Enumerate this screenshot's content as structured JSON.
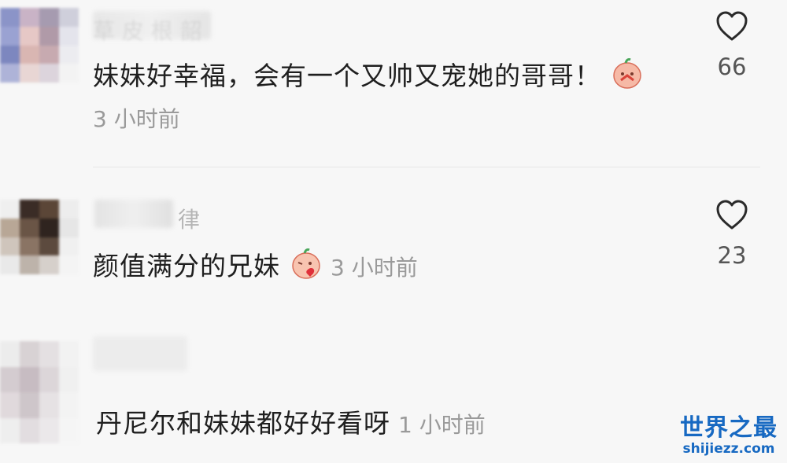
{
  "comments": [
    {
      "username_visible": "草 皮 根 韶",
      "text": "妹妹好幸福，会有一个又帅又宠她的哥哥！",
      "time": "3 小时前",
      "likes": "66",
      "emoji": "praying-face-emoji"
    },
    {
      "username_visible": "律",
      "text": "颜值满分的兄妹",
      "time": "3 小时前",
      "likes": "23",
      "emoji": "kiss-face-emoji"
    },
    {
      "username_visible": "",
      "text": "丹尼尔和妹妹都好好看呀",
      "time": "1 小时前"
    }
  ],
  "watermark": {
    "title": "世界之最",
    "url": "shijiezz.com",
    "color": "#1769c2"
  },
  "icons": {
    "like": "heart-outline-icon"
  }
}
